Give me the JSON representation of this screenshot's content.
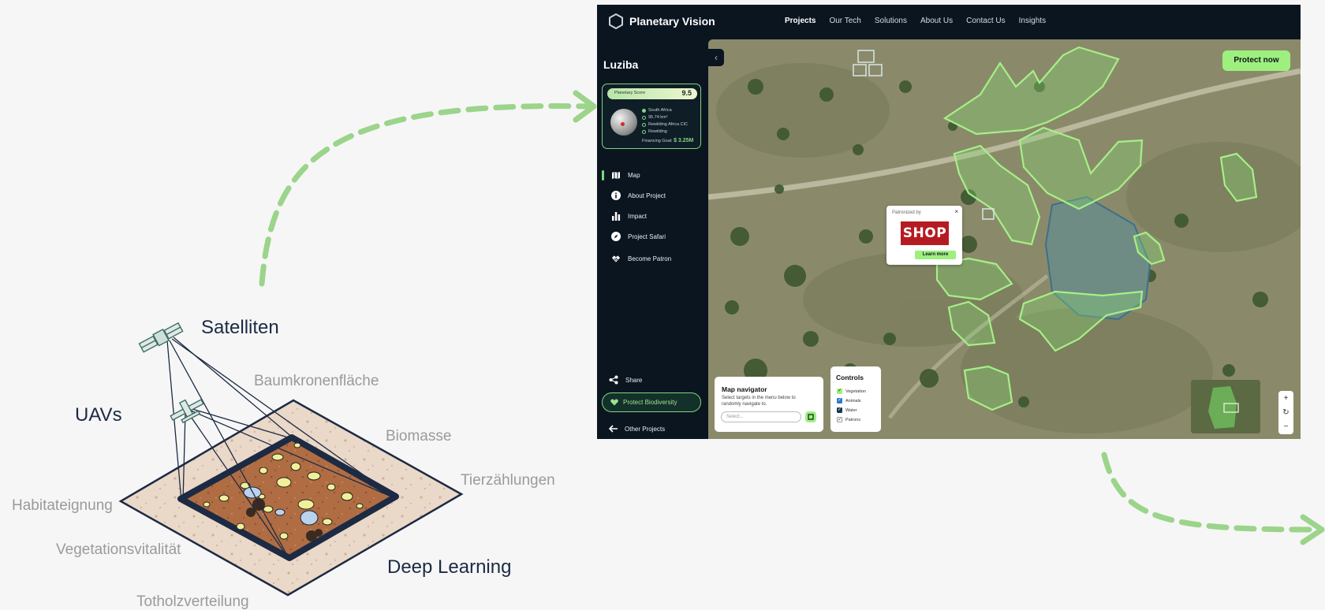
{
  "diagram": {
    "labels": {
      "satellites": "Satelliten",
      "uavs": "UAVs",
      "deep_learning": "Deep Learning",
      "crown_area": "Baumkronenfläche",
      "biomass": "Biomasse",
      "animal_counts": "Tierzählungen",
      "habitat": "Habitateignung",
      "vitality": "Vegetationsvitalität",
      "deadwood": "Totholzverteilung"
    },
    "colors": {
      "arrow": "#9bd48a",
      "label_dark": "#1b2a44",
      "label_light": "#9a9a9a"
    }
  },
  "app": {
    "brand": "Planetary Vision",
    "nav": [
      "Projects",
      "Our Tech",
      "Solutions",
      "About Us",
      "Contact Us",
      "Insights"
    ],
    "project": {
      "title": "Luziba",
      "score_label": "Planetary Score",
      "score_value": "9.5",
      "meta": [
        "South Africa",
        "95.74 km²",
        "Rewilding Africa CIC",
        "Rewilding"
      ],
      "financing_label": "Financing Goal:",
      "financing_value": "$ 3.25M"
    },
    "menu": [
      "Map",
      "About Project",
      "Impact",
      "Project Safari",
      "Become Patron"
    ],
    "share": "Share",
    "protect_bio": "Protect Biodiversity",
    "other_projects": "Other Projects",
    "protect_now": "Protect now",
    "popup": {
      "title": "Patronized by",
      "logo_text": "SHOP",
      "cta": "Learn more",
      "close": "×"
    },
    "navigator": {
      "title": "Map navigator",
      "desc": "Select targets in the menu below to randomly navigate to.",
      "placeholder": "Select..."
    },
    "controls": {
      "title": "Controls",
      "items": [
        "Vegetation",
        "Animals",
        "Water",
        "Patrons"
      ]
    },
    "zoom": [
      "+",
      "↻",
      "−"
    ],
    "colors": {
      "bg": "#0b1520",
      "accent": "#9ef07e",
      "polygon": "#9ef07e",
      "water_outline": "#3f6f8a"
    }
  }
}
